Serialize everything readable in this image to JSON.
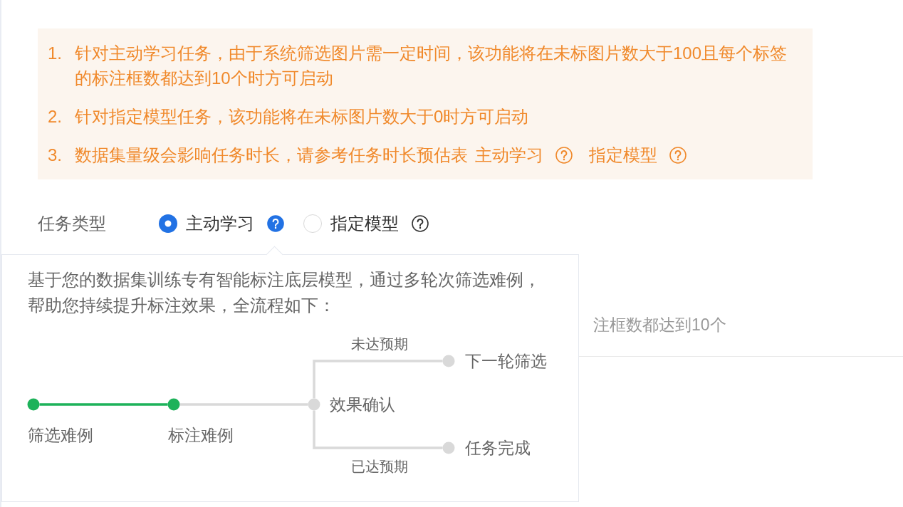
{
  "notice": {
    "items": [
      {
        "number": "1.",
        "text": "针对主动学习任务，由于系统筛选图片需一定时间，该功能将在未标图片数大于100且每个标签的标注框数都达到10个时方可启动"
      },
      {
        "number": "2.",
        "text": "针对指定模型任务，该功能将在未标图片数大于0时方可启动"
      },
      {
        "number": "3.",
        "text": "数据集量级会影响任务时长，请参考任务时长预估表",
        "links": [
          "主动学习",
          "指定模型"
        ]
      }
    ]
  },
  "task_type": {
    "label": "任务类型",
    "options": [
      {
        "label": "主动学习",
        "selected": true,
        "help_hovered": true
      },
      {
        "label": "指定模型",
        "selected": false,
        "help_hovered": false
      }
    ]
  },
  "background_hint": "注框数都达到10个",
  "popover": {
    "description": "基于您的数据集训练专有智能标注底层模型，通过多轮次筛选难例，帮助您持续提升标注效果，全流程如下：",
    "flow": {
      "steps": [
        {
          "label": "筛选难例",
          "done": true
        },
        {
          "label": "标注难例",
          "done": true
        }
      ],
      "decision": {
        "label": "效果确认",
        "done": false
      },
      "branches": [
        {
          "condition": "未达预期",
          "label": "下一轮筛选",
          "done": false
        },
        {
          "condition": "已达预期",
          "label": "任务完成",
          "done": false
        }
      ]
    }
  }
}
